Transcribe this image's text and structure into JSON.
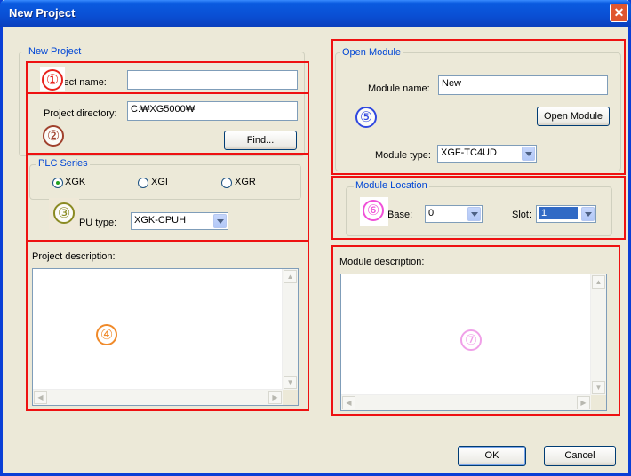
{
  "window": {
    "title": "New Project",
    "close_glyph": "✕",
    "colors": {
      "titlebar": "#0a4fd4",
      "dialog_bg": "#ece9d8",
      "highlight_box": "#e11111",
      "group_title": "#0046d5"
    }
  },
  "new_project": {
    "group_title": "New Project",
    "project_name_label": "Project name:",
    "project_name_value": "",
    "project_directory_label": "Project directory:",
    "project_directory_value": "C:₩XG5000₩",
    "find_button": "Find..."
  },
  "plc_series": {
    "group_title": "PLC Series",
    "options": [
      {
        "label": "XGK",
        "selected": true
      },
      {
        "label": "XGI",
        "selected": false
      },
      {
        "label": "XGR",
        "selected": false
      }
    ],
    "cpu_type_label": "CPU type:",
    "cpu_type_value": "XGK-CPUH"
  },
  "project_description": {
    "label": "Project description:",
    "value": ""
  },
  "open_module": {
    "group_title": "Open Module",
    "module_name_label": "Module name:",
    "module_name_value": "New",
    "open_module_button": "Open Module",
    "module_type_label": "Module type:",
    "module_type_value": "XGF-TC4UD"
  },
  "module_location": {
    "group_title": "Module Location",
    "base_label": "Base:",
    "base_value": "0",
    "slot_label": "Slot:",
    "slot_value": "1"
  },
  "module_description": {
    "label": "Module description:",
    "value": ""
  },
  "buttons": {
    "ok": "OK",
    "cancel": "Cancel"
  },
  "annotations": [
    {
      "number": "①",
      "color": "#e8231e"
    },
    {
      "number": "②",
      "color": "#a0412d"
    },
    {
      "number": "③",
      "color": "#8a8a22"
    },
    {
      "number": "④",
      "color": "#f08a2a"
    },
    {
      "number": "⑤",
      "color": "#3048e0"
    },
    {
      "number": "⑥",
      "color": "#f050d8"
    },
    {
      "number": "⑦",
      "color": "#f0a0e8"
    }
  ]
}
